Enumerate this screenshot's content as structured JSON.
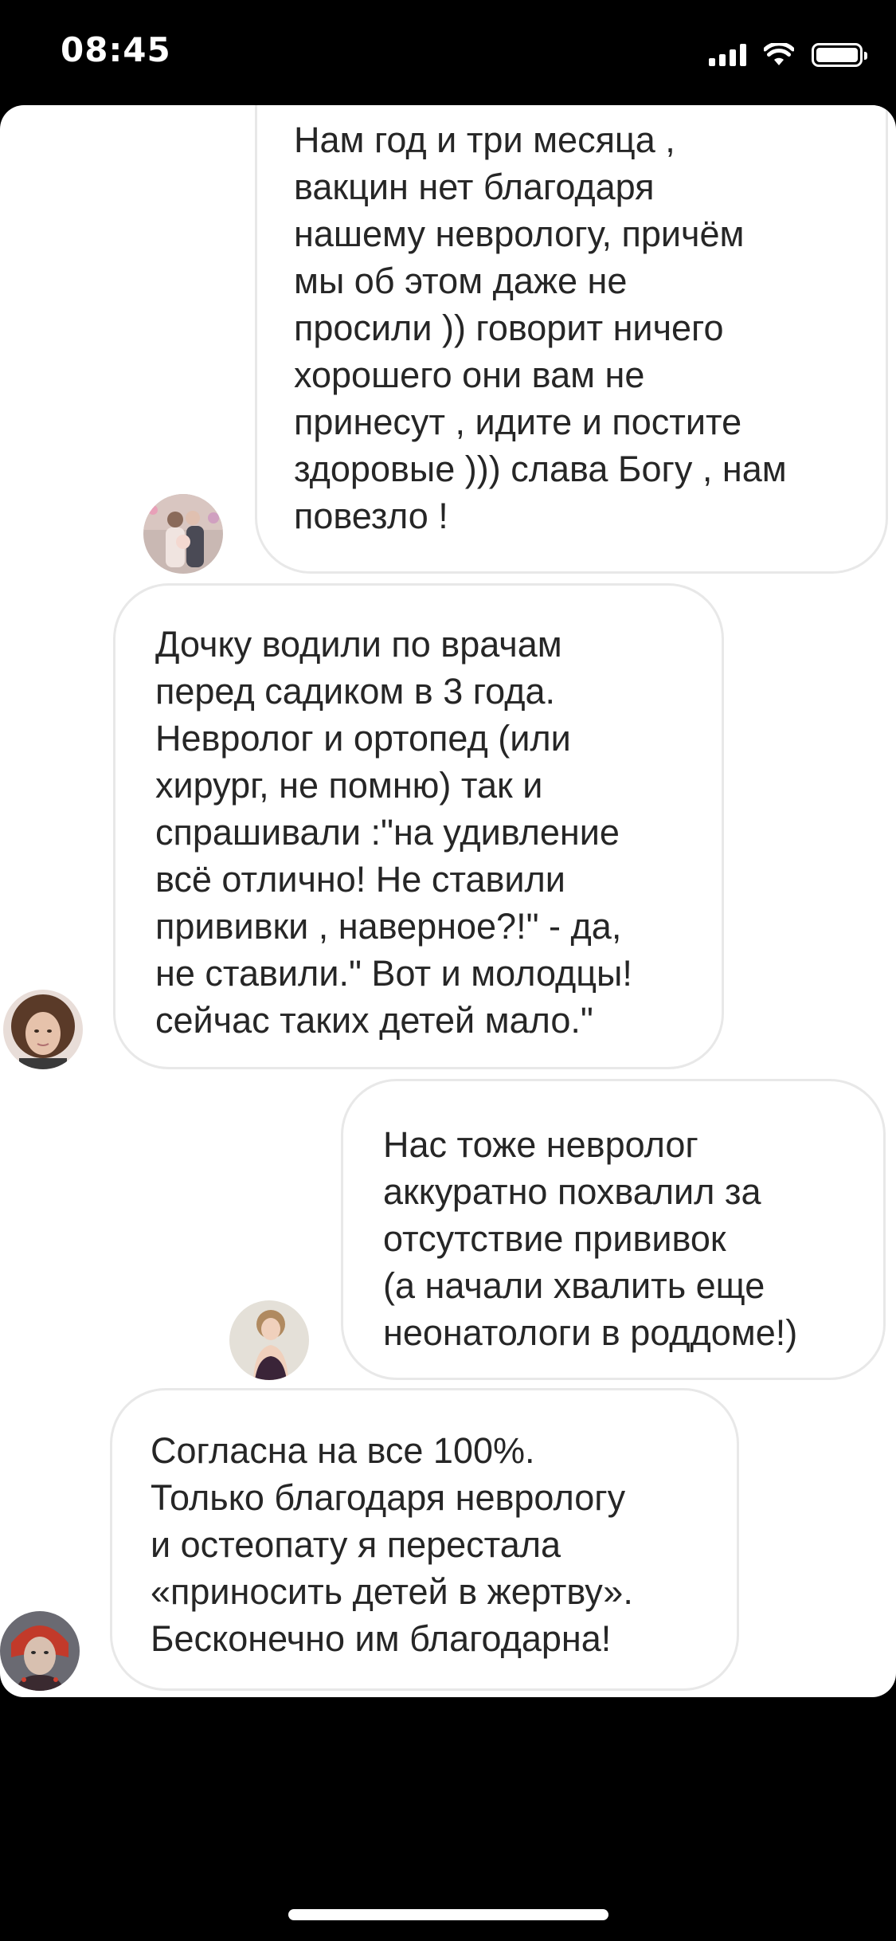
{
  "status_bar": {
    "time": "08:45",
    "icons": [
      "cellular-signal-icon",
      "wifi-icon",
      "battery-icon"
    ]
  },
  "messages": [
    {
      "sender": "outgoing",
      "text": "Нам год и три месяца ,\nвакцин нет благодаря\nнашему неврологу, причём\nмы об этом даже не\nпросили )) говорит ничего\nхорошего они вам не\nпринесут , идите и постите\nздоровые ))) слава Богу , нам\nповезло !"
    },
    {
      "sender": "incoming",
      "text": "Дочку водили по врачам\nперед садиком в 3 года.\nНевролог и ортопед (или\nхирург, не помню) так и\nспрашивали :\"на удивление\nвсё отлично! Не ставили\nпрививки , наверное?!\" - да,\nне ставили.\" Вот и молодцы!\nсейчас таких детей мало.\""
    },
    {
      "sender": "outgoing",
      "text": "Нас тоже невролог\nаккуратно похвалил за\nотсутствие прививок\n(а начали хвалить еще\nнеонатологи в роддоме!)"
    },
    {
      "sender": "incoming",
      "text": "Согласна на все 100%.\nТолько благодаря неврологу\nи остеопату я перестала\n«приносить детей в жертву».\nБесконечно им благодарна!"
    }
  ],
  "colors": {
    "background": "#000000",
    "panel": "#ffffff",
    "bubble_border": "#e8e8e8",
    "text": "#262626"
  }
}
